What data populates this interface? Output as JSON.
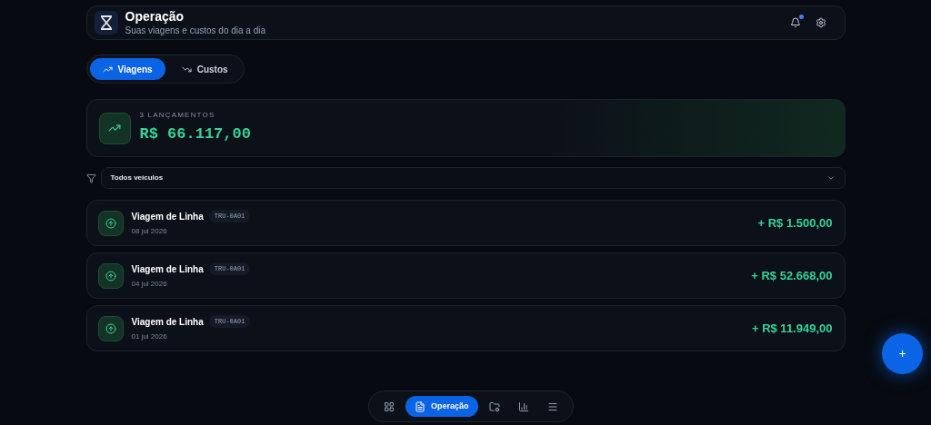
{
  "header": {
    "title": "Operação",
    "subtitle": "Suas viagens e custos do dia a dia",
    "notifications_unread": true
  },
  "tabs": [
    {
      "label": "Viagens",
      "kind": "up",
      "selected": true
    },
    {
      "label": "Custos",
      "kind": "down",
      "selected": false
    }
  ],
  "summary": {
    "count_label": "3 LANÇAMENTOS",
    "total": "R$ 66.117,00"
  },
  "filter": {
    "value": "Todos veículos"
  },
  "entries": [
    {
      "title": "Viagem de Linha",
      "tag": "TRU-0A01",
      "date": "08 jul 2026",
      "amount": "+ R$ 1.500,00"
    },
    {
      "title": "Viagem de Linha",
      "tag": "TRU-0A01",
      "date": "04 jul 2026",
      "amount": "+ R$ 52.668,00"
    },
    {
      "title": "Viagem de Linha",
      "tag": "TRU-0A01",
      "date": "01 jul 2026",
      "amount": "+ R$ 11.949,00"
    }
  ],
  "bottom_nav": [
    {
      "kind": "dashboard",
      "selected": false
    },
    {
      "kind": "operation",
      "label": "Operação",
      "selected": true
    },
    {
      "kind": "folder",
      "selected": false
    },
    {
      "kind": "chart",
      "selected": false
    },
    {
      "kind": "menu",
      "selected": false
    }
  ],
  "fab": {
    "label": "+"
  }
}
